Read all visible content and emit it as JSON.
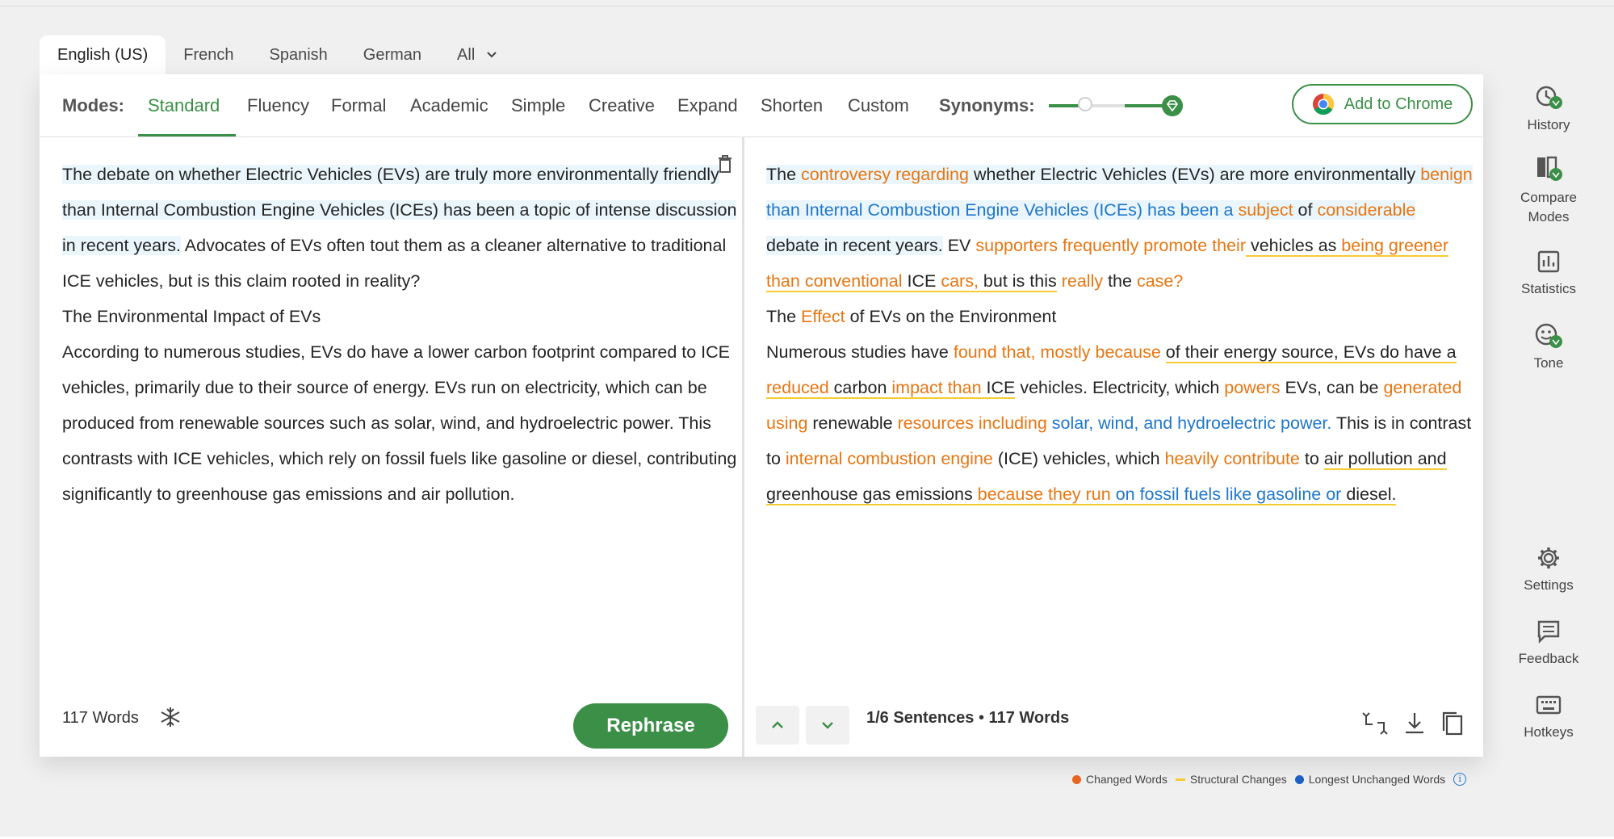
{
  "language_tabs": [
    "English (US)",
    "French",
    "Spanish",
    "German",
    "All"
  ],
  "modes": {
    "label": "Modes:",
    "items": [
      "Standard",
      "Fluency",
      "Formal",
      "Academic",
      "Simple",
      "Creative",
      "Expand",
      "Shorten",
      "Custom"
    ],
    "active": "Standard"
  },
  "synonyms": {
    "label": "Synonyms:",
    "level": 0.25
  },
  "chrome_button": {
    "label": "Add to Chrome"
  },
  "input": {
    "paragraphs": [
      [
        "The debate on whether Electric Vehicles (EVs) are truly more environmentally friendly than Internal Combustion Engine Vehicles (ICEs) has been a topic of intense discussion in recent years.",
        " Advocates of EVs often tout them as a cleaner alternative to traditional ICE vehicles, but is this claim rooted in reality?"
      ],
      [
        "The Environmental Impact of EVs"
      ],
      [
        "According to numerous studies, EVs do have a lower carbon footprint compared to ICE vehicles, primarily due to their source of energy. EVs run on electricity, which can be produced from renewable sources such as solar, wind, and hydroelectric power. This contrasts with ICE vehicles, which rely on fossil fuels like gasoline or diesel, contributing significantly to greenhouse gas emissions and air pollution."
      ]
    ],
    "word_count": "117 Words"
  },
  "rephrase_button": "Rephrase",
  "output": {
    "paragraphs": [
      [
        {
          "t": "The ",
          "s": "hl"
        },
        {
          "t": "controversy regarding",
          "s": "hl chg"
        },
        {
          "t": " whether Electric Vehicles (EVs) are more environmentally ",
          "s": "hl"
        },
        {
          "t": "benign",
          "s": "hl chg"
        },
        {
          "t": " than Internal Combustion Engine Vehicles (ICEs) has been a ",
          "s": "hl lng"
        },
        {
          "t": "subject",
          "s": "hl chg"
        },
        {
          "t": " of ",
          "s": "hl"
        },
        {
          "t": "considerable",
          "s": "hl chg"
        },
        {
          "t": " debate in recent years.",
          "s": "hl"
        },
        {
          "t": " EV ",
          "s": ""
        },
        {
          "t": "supporters frequently promote their",
          "s": "chg"
        },
        {
          "t": " vehicles as ",
          "s": "str"
        },
        {
          "t": "being greener than conventional",
          "s": "str chg"
        },
        {
          "t": " ICE ",
          "s": "str"
        },
        {
          "t": "cars,",
          "s": "str chg"
        },
        {
          "t": " but is this",
          "s": "str"
        },
        {
          "t": " ",
          "s": ""
        },
        {
          "t": "really",
          "s": "chg"
        },
        {
          "t": " the ",
          "s": ""
        },
        {
          "t": "case?",
          "s": "chg"
        }
      ],
      [
        {
          "t": "The ",
          "s": ""
        },
        {
          "t": "Effect",
          "s": "chg"
        },
        {
          "t": " of EVs on the Environment",
          "s": ""
        }
      ],
      [
        {
          "t": "Numerous studies have ",
          "s": ""
        },
        {
          "t": "found that, mostly because",
          "s": "chg"
        },
        {
          "t": " ",
          "s": ""
        },
        {
          "t": "of their energy source, EVs do have a ",
          "s": "str"
        },
        {
          "t": "reduced",
          "s": "str chg"
        },
        {
          "t": " carbon ",
          "s": "str"
        },
        {
          "t": "impact than",
          "s": "str chg"
        },
        {
          "t": " ICE",
          "s": "str"
        },
        {
          "t": " vehicles. Electricity, which ",
          "s": ""
        },
        {
          "t": "powers",
          "s": "chg"
        },
        {
          "t": " EVs, can be ",
          "s": ""
        },
        {
          "t": "generated using",
          "s": "chg"
        },
        {
          "t": " renewable ",
          "s": ""
        },
        {
          "t": "resources including",
          "s": "chg"
        },
        {
          "t": " ",
          "s": ""
        },
        {
          "t": "solar, wind, and hydroelectric power.",
          "s": "lng"
        },
        {
          "t": " This is in contrast to ",
          "s": ""
        },
        {
          "t": "internal combustion engine",
          "s": "chg"
        },
        {
          "t": " (ICE) vehicles, which ",
          "s": ""
        },
        {
          "t": "heavily contribute",
          "s": "chg"
        },
        {
          "t": " to ",
          "s": ""
        },
        {
          "t": "air pollution and greenhouse gas emissions ",
          "s": "str"
        },
        {
          "t": "because they run",
          "s": "str chg"
        },
        {
          "t": " ",
          "s": "str"
        },
        {
          "t": "on fossil fuels like gasoline or",
          "s": "str lng"
        },
        {
          "t": " diesel.",
          "s": "str"
        }
      ]
    ],
    "sentence_info": "1/6 Sentences",
    "word_count": "117 Words"
  },
  "legend": {
    "items": [
      {
        "label": "Changed Words",
        "color": "#e8641f",
        "kind": "dot"
      },
      {
        "label": "Structural Changes",
        "color": "#f5cc33",
        "kind": "bar"
      },
      {
        "label": "Longest Unchanged Words",
        "color": "#1f60c4",
        "kind": "dot"
      }
    ]
  },
  "sidebar": {
    "items": [
      "History",
      "Compare Modes",
      "Statistics",
      "Tone",
      "Settings",
      "Feedback",
      "Hotkeys"
    ]
  },
  "colors": {
    "accent": "#3b8f47",
    "changed": "#e77612",
    "unchanged": "#1f77cc",
    "structural": "#f5cc33",
    "highlight": "#eaf6fb"
  }
}
